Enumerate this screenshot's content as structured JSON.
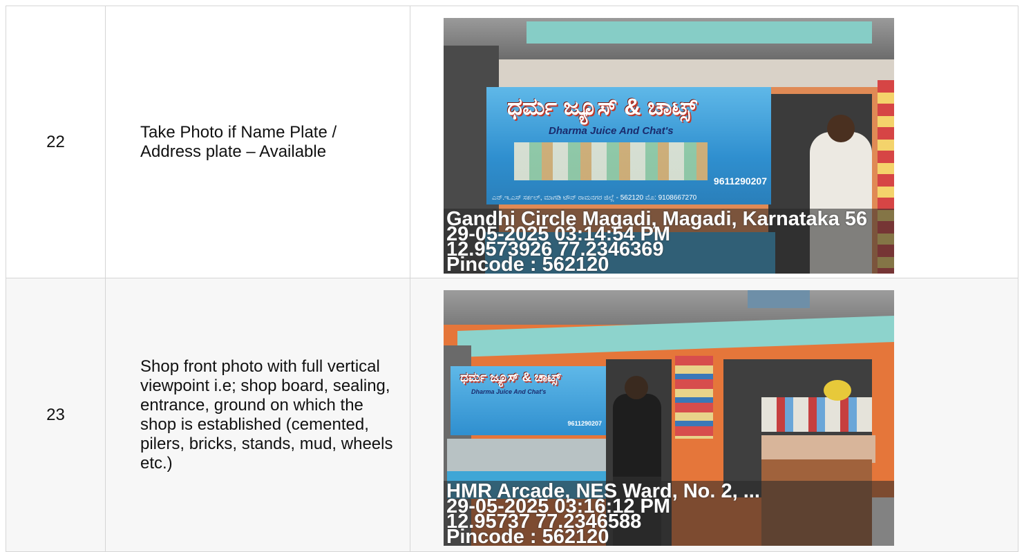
{
  "rows": [
    {
      "number": "22",
      "description": "Take Photo if Name Plate / Address plate – Available",
      "photo": {
        "sign_title": "ಧರ್ಮ ಜ್ಯೂಸ್ & ಚಾಟ್ಸ್",
        "sign_subtitle": "Dharma Juice And Chat's",
        "sign_phone": "9611290207",
        "sign_address": "ಎನ್.ಇ.ಎಸ್ ಸರ್ಕಲ್, ಮಾಗಡಿ ಟೌನ್ ರಾಮನಗರ ಜಿಲ್ಲೆ - 562120 ಮೊ: 9108667270",
        "overlay": [
          "Gandhi Circle Magadi, Magadi, Karnataka 56",
          "29-05-2025 03:14:54 PM",
          "12.9573926 77.2346369",
          "Pincode : 562120"
        ]
      }
    },
    {
      "number": "23",
      "description": "Shop front photo with full vertical viewpoint i.e; shop board, sealing, entrance, ground on which the shop is established (cemented, pilers, bricks, stands, mud, wheels etc.)",
      "photo": {
        "sign_title": "ಧರ್ಮ ಜ್ಯೂಸ್ & ಚಾಟ್ಸ್",
        "sign_subtitle": "Dharma Juice And Chat's",
        "sign_phone": "9611290207",
        "overlay": [
          "HMR Arcade, NES Ward, No. 2, ...",
          "29-05-2025 03:16:12 PM",
          "12.95737 77.2346588",
          "Pincode : 562120"
        ]
      }
    }
  ],
  "colors": {
    "wall_orange": "#e5763a",
    "roof_teal": "#7cc9c4",
    "sign_blue": "#3a9ad9",
    "grid_border": "#d5d5d5"
  }
}
